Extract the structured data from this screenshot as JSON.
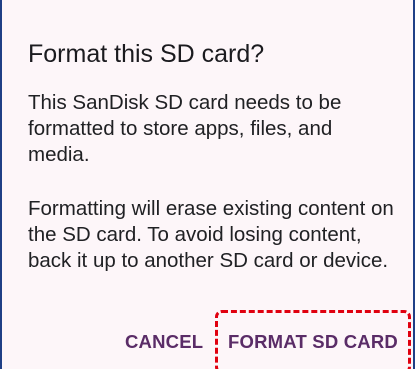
{
  "dialog": {
    "title": "Format this SD card?",
    "body_paragraph_1": "This SanDisk SD card needs to be formatted to store apps, files, and media.",
    "body_paragraph_2": "Formatting will erase existing content on the SD card. To avoid losing content, back it up to another SD card or device.",
    "buttons": {
      "cancel_label": "CANCEL",
      "format_label": "FORMAT SD CARD"
    }
  },
  "annotation": {
    "highlight_color": "#e0000f",
    "highlight_style": "dashed-rounded-rectangle",
    "highlight_target": "format-sd-card-button"
  },
  "colors": {
    "dialog_background": "#fdf6f9",
    "button_text": "#5a2c67",
    "frame_edge": "#1f3f86",
    "text": "#1b1b1f"
  }
}
